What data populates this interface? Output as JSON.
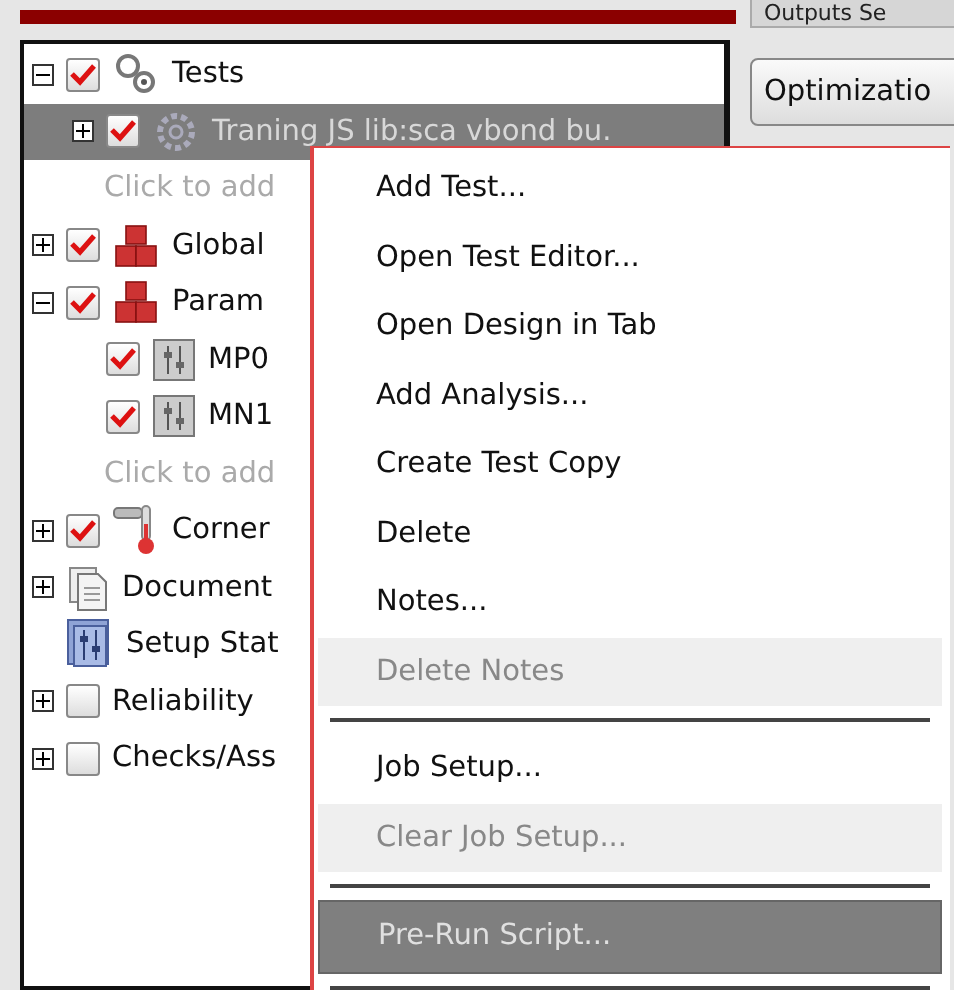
{
  "tree": {
    "items": [
      {
        "label": "Tests",
        "kind": "gears",
        "expanded": true,
        "checked": true,
        "selected": false,
        "children": [
          {
            "label": "Traning JS lib:sca vbond bu.",
            "kind": "gear",
            "expanded": false,
            "checked": true,
            "selected": true
          },
          {
            "label": "Click to add",
            "kind": "hint",
            "selected": false
          }
        ]
      },
      {
        "label": "Global",
        "kind": "blocks",
        "expanded": false,
        "checked": true,
        "selected": false
      },
      {
        "label": "Param",
        "kind": "blocks",
        "expanded": true,
        "checked": true,
        "selected": false,
        "children": [
          {
            "label": "MP0",
            "kind": "param",
            "checked": true,
            "selected": false
          },
          {
            "label": "MN1",
            "kind": "param",
            "checked": true,
            "selected": false
          },
          {
            "label": "Click to add",
            "kind": "hint",
            "selected": false
          }
        ]
      },
      {
        "label": "Corner",
        "kind": "thermometer",
        "expanded": false,
        "checked": true,
        "selected": false
      },
      {
        "label": "Document",
        "kind": "document",
        "expanded": false,
        "selected": false
      },
      {
        "label": "Setup Stat",
        "kind": "setup",
        "selected": false
      },
      {
        "label": "Reliability",
        "kind": "plain",
        "expanded": false,
        "checked": false,
        "selected": false
      },
      {
        "label": "Checks/Ass",
        "kind": "plain",
        "expanded": false,
        "checked": false,
        "selected": false
      }
    ]
  },
  "side_panel": {
    "tab": "Outputs Se",
    "button": "Optimizatio"
  },
  "context_menu": [
    {
      "kind": "item",
      "label": "Add Test...",
      "disabled": false,
      "selected": false
    },
    {
      "kind": "item",
      "label": "Open Test Editor...",
      "disabled": false,
      "selected": false
    },
    {
      "kind": "item",
      "label": "Open Design in Tab",
      "disabled": false,
      "selected": false
    },
    {
      "kind": "item",
      "label": "Add Analysis...",
      "disabled": false,
      "selected": false
    },
    {
      "kind": "item",
      "label": "Create Test Copy",
      "disabled": false,
      "selected": false
    },
    {
      "kind": "item",
      "label": "Delete",
      "disabled": false,
      "selected": false
    },
    {
      "kind": "item",
      "label": "Notes...",
      "disabled": false,
      "selected": false
    },
    {
      "kind": "item",
      "label": "Delete Notes",
      "disabled": true,
      "selected": false
    },
    {
      "kind": "separator"
    },
    {
      "kind": "item",
      "label": "Job Setup...",
      "disabled": false,
      "selected": false
    },
    {
      "kind": "item",
      "label": "Clear Job Setup...",
      "disabled": true,
      "selected": false
    },
    {
      "kind": "separator"
    },
    {
      "kind": "item",
      "label": "Pre-Run Script...",
      "disabled": false,
      "selected": true
    },
    {
      "kind": "separator"
    }
  ]
}
